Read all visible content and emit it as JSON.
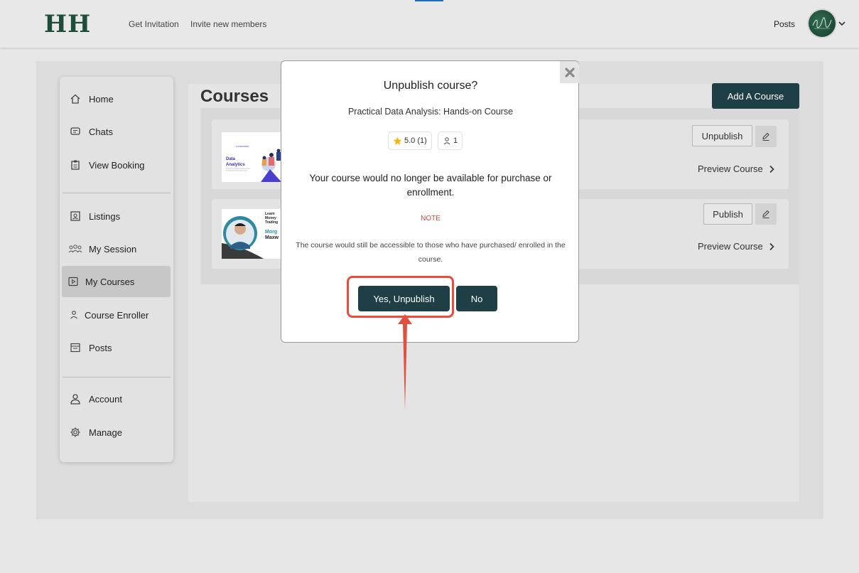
{
  "header": {
    "logo": "HH",
    "nav": [
      "Get Invitation",
      "Invite new members"
    ],
    "posts": "Posts"
  },
  "sidebar": {
    "items": [
      {
        "label": "Home",
        "icon": "home-icon"
      },
      {
        "label": "Chats",
        "icon": "chat-icon"
      },
      {
        "label": "View Booking",
        "icon": "clipboard-icon"
      },
      {
        "label": "Listings",
        "icon": "listing-icon"
      },
      {
        "label": "My Session",
        "icon": "group-icon"
      },
      {
        "label": "My Courses",
        "icon": "play-icon"
      },
      {
        "label": "Course Enroller",
        "icon": "user-icon"
      },
      {
        "label": "Posts",
        "icon": "posts-icon"
      },
      {
        "label": "Account",
        "icon": "account-icon"
      },
      {
        "label": "Manage",
        "icon": "gear-icon"
      }
    ],
    "active": "My Courses"
  },
  "main": {
    "title": "Courses",
    "add_course": "Add A Course",
    "cards": [
      {
        "action": "Unpublish",
        "preview": "Preview Course",
        "thumb_text": [
          "Data",
          "Analytics"
        ]
      },
      {
        "action": "Publish",
        "preview": "Preview Course",
        "thumb_text": [
          "Learn",
          "Money",
          "Trading",
          "Morg",
          "Maxw"
        ]
      }
    ]
  },
  "modal": {
    "title": "Unpublish course?",
    "course_name": "Practical Data Analysis: Hands-on Course",
    "rating": "5.0 (1)",
    "students": "1",
    "body": "Your course would no longer be available for purchase or enrollment.",
    "note": "NOTE",
    "small": "The course would still be accessible to those who have purchased/ enrolled in the course.",
    "confirm": "Yes, Unpublish",
    "cancel": "No"
  },
  "colors": {
    "primary": "#1f3f47",
    "logo": "#1e4d3a",
    "note": "#d64545",
    "highlight": "#e2503f"
  }
}
